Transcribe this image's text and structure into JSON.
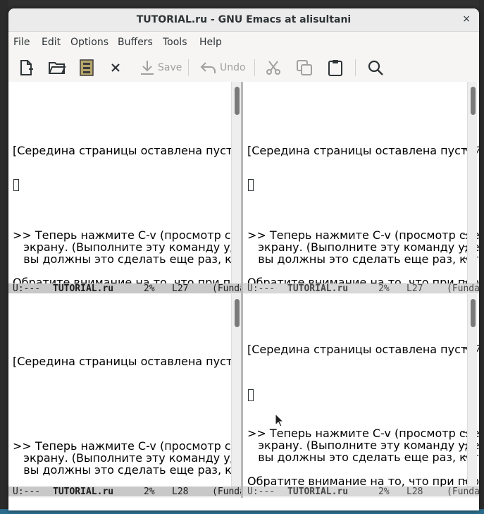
{
  "window": {
    "title": "TUTORIAL.ru - GNU Emacs at alisultani",
    "close_glyph": "×"
  },
  "menubar": {
    "items": [
      "File",
      "Edit",
      "Options",
      "Buffers",
      "Tools",
      "Help"
    ]
  },
  "toolbar": {
    "new_file": "new-file-icon",
    "open": "open-folder-icon",
    "dired": "cabinet-icon",
    "close": "close-icon",
    "save_label": "Save",
    "undo_label": "Undo",
    "cut": "scissors-icon",
    "copy": "copy-icon",
    "paste": "paste-icon",
    "search": "search-icon"
  },
  "buffer": {
    "line_middle": "[Середина страницы оставлена пустой в",
    "line_cmd1": ">> Теперь нажмите C-v (просмотр следую",
    "line_cmd2": "   экрану. (Выполните эту команду удер",
    "line_cmd3": "   вы должны это сделать еще раз, когд",
    "line_note": "Обратите внимание на то, что при перех",
    "continuation": "→"
  },
  "panes": [
    {
      "modeline": {
        "status": "U:---",
        "buffer": "TUTORIAL.ru",
        "percent": "2%",
        "line": "L27",
        "mode": "(Funda"
      },
      "active": true
    },
    {
      "modeline": {
        "status": "U:---",
        "buffer": "TUTORIAL.ru",
        "percent": "2%",
        "line": "L27",
        "mode": "(Funda"
      },
      "active": false
    },
    {
      "modeline": {
        "status": "U:---",
        "buffer": "TUTORIAL.ru",
        "percent": "2%",
        "line": "L28",
        "mode": "(Funda"
      },
      "active": true
    },
    {
      "modeline": {
        "status": "U:---",
        "buffer": "TUTORIAL.ru",
        "percent": "2%",
        "line": "L28",
        "mode": "(Funda"
      },
      "active": false
    }
  ],
  "colors": {
    "accent": "#2e3436",
    "modeline_active": "#c8c8c8",
    "modeline_inactive": "#d8d8d8"
  }
}
